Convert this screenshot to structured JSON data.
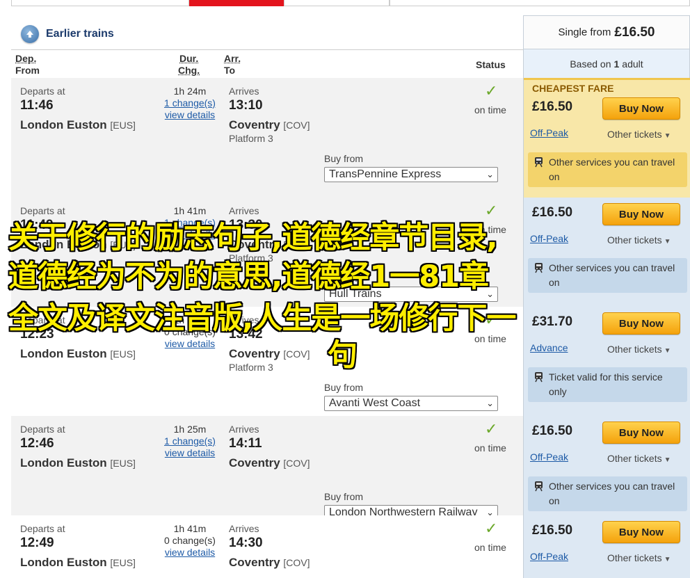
{
  "header": {
    "earlier_trains": "Earlier trains",
    "single_from_prefix": "Single from",
    "single_from_price": "£16.50",
    "based_on_prefix": "Based on",
    "based_on_count": "1",
    "based_on_suffix": "adult"
  },
  "columns": {
    "dep": "Dep.",
    "from": "From",
    "dur": "Dur.",
    "chg": "Chg.",
    "arr": "Arr.",
    "to": "To",
    "status": "Status"
  },
  "labels": {
    "departs_at": "Departs at",
    "arrives": "Arrives",
    "view_details": "view details",
    "on_time": "on time",
    "buy_from": "Buy from",
    "buy_now": "Buy Now",
    "other_tickets": "Other tickets",
    "cheapest_fare": "CHEAPEST FARE"
  },
  "journeys": [
    {
      "dep_time": "11:46",
      "from_name": "London Euston",
      "from_code": "[EUS]",
      "duration": "1h 24m",
      "changes": "1 change(s)",
      "arr_time": "13:10",
      "to_name": "Coventry",
      "to_code": "[COV]",
      "platform": "Platform 3",
      "operator": "TransPennine Express",
      "price": "£16.50",
      "fare_type": "Off-Peak",
      "info": "Other services you can travel on"
    },
    {
      "dep_time": "11:49",
      "from_name": "London Euston",
      "from_code": "[EUS]",
      "duration": "1h 41m",
      "changes": "1 change(s)",
      "arr_time": "13:30",
      "to_name": "Coventry",
      "to_code": "[COV]",
      "platform": "Platform 3",
      "operator": "Hull Trains",
      "price": "£16.50",
      "fare_type": "Off-Peak",
      "info": "Other services you can travel on"
    },
    {
      "dep_time": "12:23",
      "from_name": "London Euston",
      "from_code": "[EUS]",
      "duration": "1h 19m",
      "changes": "0 change(s)",
      "arr_time": "13:42",
      "to_name": "Coventry",
      "to_code": "[COV]",
      "platform": "Platform 3",
      "operator": "Avanti West Coast",
      "price": "£31.70",
      "fare_type": "Advance",
      "info": "Ticket valid for this service only"
    },
    {
      "dep_time": "12:46",
      "from_name": "London Euston",
      "from_code": "[EUS]",
      "duration": "1h 25m",
      "changes": "1 change(s)",
      "arr_time": "14:11",
      "to_name": "Coventry",
      "to_code": "[COV]",
      "platform": "",
      "operator": "London Northwestern Railway",
      "price": "£16.50",
      "fare_type": "Off-Peak",
      "info": "Other services you can travel on"
    },
    {
      "dep_time": "12:49",
      "from_name": "London Euston",
      "from_code": "[EUS]",
      "duration": "1h 41m",
      "changes": "0 change(s)",
      "arr_time": "14:30",
      "to_name": "Coventry",
      "to_code": "[COV]",
      "platform": "",
      "operator": "",
      "price": "£16.50",
      "fare_type": "Off-Peak",
      "info": ""
    }
  ],
  "overlay_text": [
    "关于修行的励志句子,道德经章节目录,",
    "道德经为不为的意思,道德经1一81章",
    "全文及译文注音版,人生是一场修行下一",
    "句"
  ],
  "colors": {
    "link": "#1d5aa6",
    "buy_button": "#f4a20c",
    "check": "#6ba82a",
    "cheapest_bg": "#f8e7a8",
    "fare_bg": "#dde8f3",
    "overlay": "#ffee00"
  }
}
